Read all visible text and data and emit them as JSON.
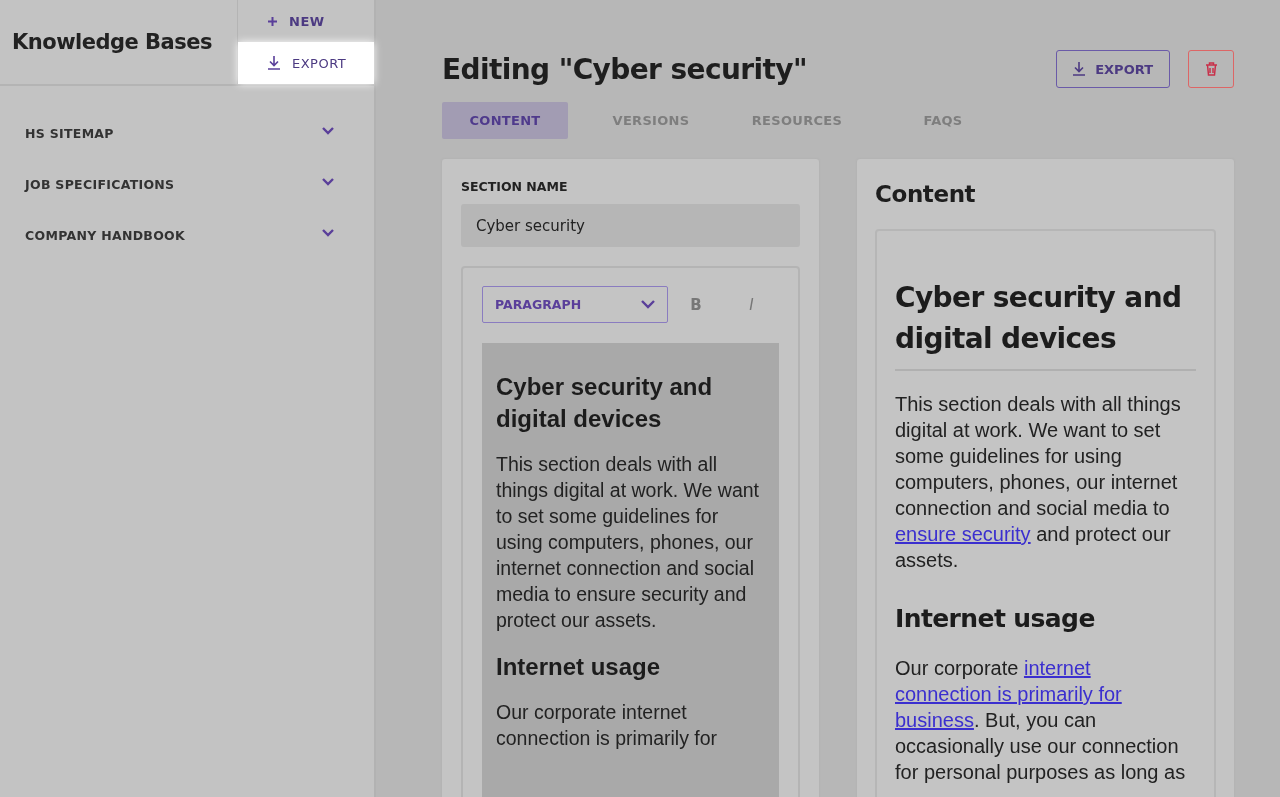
{
  "sidebar": {
    "title": "Knowledge Bases",
    "actions": [
      {
        "kind": "new",
        "label": "NEW",
        "highlighted": false
      },
      {
        "kind": "export",
        "label": "EXPORT",
        "highlighted": true
      }
    ],
    "items": [
      {
        "label": "HS SITEMAP",
        "expanded": false
      },
      {
        "label": "JOB SPECIFICATIONS",
        "expanded": false
      },
      {
        "label": "COMPANY HANDBOOK",
        "expanded": false
      }
    ]
  },
  "header": {
    "title": "Editing \"Cyber security\"",
    "actions": [
      {
        "kind": "export",
        "label": "EXPORT"
      },
      {
        "kind": "delete"
      }
    ]
  },
  "tabs": [
    {
      "label": "CONTENT",
      "selected": true
    },
    {
      "label": "VERSIONS",
      "selected": false
    },
    {
      "label": "RESOURCES",
      "selected": false
    },
    {
      "label": "FAQS",
      "selected": false
    }
  ],
  "editor": {
    "section_name_label": "SECTION NAME",
    "section_name": "Cyber security",
    "block_type": "PARAGRAPH",
    "format_buttons": [
      {
        "kind": "bold",
        "label": "B"
      },
      {
        "kind": "italic",
        "label": "I"
      }
    ],
    "blocks": [
      {
        "kind": "heading",
        "segments": [
          {
            "text": "Cyber security and digital devices"
          }
        ]
      },
      {
        "kind": "paragraph",
        "segments": [
          {
            "text": "This section deals with all things digital at work. We want to set some guidelines for using computers, phones, our internet connection and social media to ensure security and protect our assets."
          }
        ]
      },
      {
        "kind": "heading",
        "segments": [
          {
            "text": "Internet usage"
          }
        ]
      },
      {
        "kind": "paragraph",
        "segments": [
          {
            "text": "Our corporate internet connection is primarily for"
          }
        ]
      }
    ]
  },
  "preview": {
    "title": "Content",
    "blocks": [
      {
        "kind": "heading",
        "segments": [
          {
            "text": "Cyber security and digital devices"
          }
        ]
      },
      {
        "kind": "paragraph",
        "segments": [
          {
            "text": "This section deals with all things digital at work. We want to set some guidelines for using computers, phones, our internet connection and social media to "
          },
          {
            "text": "ensure security",
            "link": true
          },
          {
            "text": " and protect our assets."
          }
        ]
      },
      {
        "kind": "heading",
        "segments": [
          {
            "text": "Internet usage"
          }
        ]
      },
      {
        "kind": "paragraph",
        "segments": [
          {
            "text": "Our corporate "
          },
          {
            "text": "internet",
            "link": true
          },
          {
            "text": "connection is primarily for",
            "link": true
          },
          {
            "text": "business",
            "link": true
          },
          {
            "text": ". But, you can occasionally use our connection for personal purposes as long as"
          }
        ]
      }
    ]
  }
}
